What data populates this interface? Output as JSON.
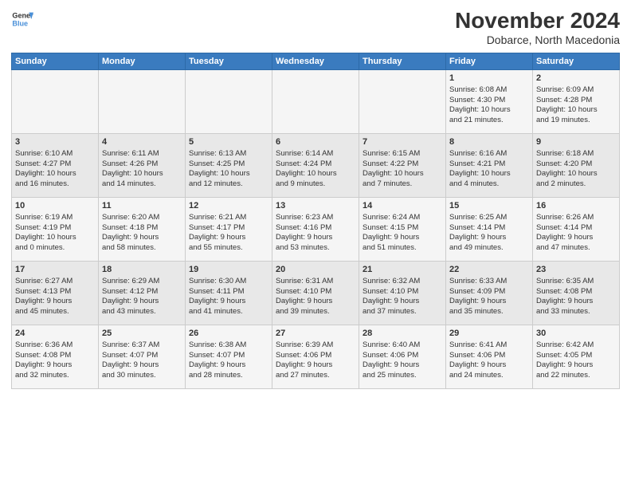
{
  "logo": {
    "line1": "General",
    "line2": "Blue"
  },
  "title": "November 2024",
  "subtitle": "Dobarce, North Macedonia",
  "headers": [
    "Sunday",
    "Monday",
    "Tuesday",
    "Wednesday",
    "Thursday",
    "Friday",
    "Saturday"
  ],
  "weeks": [
    [
      {
        "day": "",
        "info": ""
      },
      {
        "day": "",
        "info": ""
      },
      {
        "day": "",
        "info": ""
      },
      {
        "day": "",
        "info": ""
      },
      {
        "day": "",
        "info": ""
      },
      {
        "day": "1",
        "info": "Sunrise: 6:08 AM\nSunset: 4:30 PM\nDaylight: 10 hours\nand 21 minutes."
      },
      {
        "day": "2",
        "info": "Sunrise: 6:09 AM\nSunset: 4:28 PM\nDaylight: 10 hours\nand 19 minutes."
      }
    ],
    [
      {
        "day": "3",
        "info": "Sunrise: 6:10 AM\nSunset: 4:27 PM\nDaylight: 10 hours\nand 16 minutes."
      },
      {
        "day": "4",
        "info": "Sunrise: 6:11 AM\nSunset: 4:26 PM\nDaylight: 10 hours\nand 14 minutes."
      },
      {
        "day": "5",
        "info": "Sunrise: 6:13 AM\nSunset: 4:25 PM\nDaylight: 10 hours\nand 12 minutes."
      },
      {
        "day": "6",
        "info": "Sunrise: 6:14 AM\nSunset: 4:24 PM\nDaylight: 10 hours\nand 9 minutes."
      },
      {
        "day": "7",
        "info": "Sunrise: 6:15 AM\nSunset: 4:22 PM\nDaylight: 10 hours\nand 7 minutes."
      },
      {
        "day": "8",
        "info": "Sunrise: 6:16 AM\nSunset: 4:21 PM\nDaylight: 10 hours\nand 4 minutes."
      },
      {
        "day": "9",
        "info": "Sunrise: 6:18 AM\nSunset: 4:20 PM\nDaylight: 10 hours\nand 2 minutes."
      }
    ],
    [
      {
        "day": "10",
        "info": "Sunrise: 6:19 AM\nSunset: 4:19 PM\nDaylight: 10 hours\nand 0 minutes."
      },
      {
        "day": "11",
        "info": "Sunrise: 6:20 AM\nSunset: 4:18 PM\nDaylight: 9 hours\nand 58 minutes."
      },
      {
        "day": "12",
        "info": "Sunrise: 6:21 AM\nSunset: 4:17 PM\nDaylight: 9 hours\nand 55 minutes."
      },
      {
        "day": "13",
        "info": "Sunrise: 6:23 AM\nSunset: 4:16 PM\nDaylight: 9 hours\nand 53 minutes."
      },
      {
        "day": "14",
        "info": "Sunrise: 6:24 AM\nSunset: 4:15 PM\nDaylight: 9 hours\nand 51 minutes."
      },
      {
        "day": "15",
        "info": "Sunrise: 6:25 AM\nSunset: 4:14 PM\nDaylight: 9 hours\nand 49 minutes."
      },
      {
        "day": "16",
        "info": "Sunrise: 6:26 AM\nSunset: 4:14 PM\nDaylight: 9 hours\nand 47 minutes."
      }
    ],
    [
      {
        "day": "17",
        "info": "Sunrise: 6:27 AM\nSunset: 4:13 PM\nDaylight: 9 hours\nand 45 minutes."
      },
      {
        "day": "18",
        "info": "Sunrise: 6:29 AM\nSunset: 4:12 PM\nDaylight: 9 hours\nand 43 minutes."
      },
      {
        "day": "19",
        "info": "Sunrise: 6:30 AM\nSunset: 4:11 PM\nDaylight: 9 hours\nand 41 minutes."
      },
      {
        "day": "20",
        "info": "Sunrise: 6:31 AM\nSunset: 4:10 PM\nDaylight: 9 hours\nand 39 minutes."
      },
      {
        "day": "21",
        "info": "Sunrise: 6:32 AM\nSunset: 4:10 PM\nDaylight: 9 hours\nand 37 minutes."
      },
      {
        "day": "22",
        "info": "Sunrise: 6:33 AM\nSunset: 4:09 PM\nDaylight: 9 hours\nand 35 minutes."
      },
      {
        "day": "23",
        "info": "Sunrise: 6:35 AM\nSunset: 4:08 PM\nDaylight: 9 hours\nand 33 minutes."
      }
    ],
    [
      {
        "day": "24",
        "info": "Sunrise: 6:36 AM\nSunset: 4:08 PM\nDaylight: 9 hours\nand 32 minutes."
      },
      {
        "day": "25",
        "info": "Sunrise: 6:37 AM\nSunset: 4:07 PM\nDaylight: 9 hours\nand 30 minutes."
      },
      {
        "day": "26",
        "info": "Sunrise: 6:38 AM\nSunset: 4:07 PM\nDaylight: 9 hours\nand 28 minutes."
      },
      {
        "day": "27",
        "info": "Sunrise: 6:39 AM\nSunset: 4:06 PM\nDaylight: 9 hours\nand 27 minutes."
      },
      {
        "day": "28",
        "info": "Sunrise: 6:40 AM\nSunset: 4:06 PM\nDaylight: 9 hours\nand 25 minutes."
      },
      {
        "day": "29",
        "info": "Sunrise: 6:41 AM\nSunset: 4:06 PM\nDaylight: 9 hours\nand 24 minutes."
      },
      {
        "day": "30",
        "info": "Sunrise: 6:42 AM\nSunset: 4:05 PM\nDaylight: 9 hours\nand 22 minutes."
      }
    ]
  ]
}
